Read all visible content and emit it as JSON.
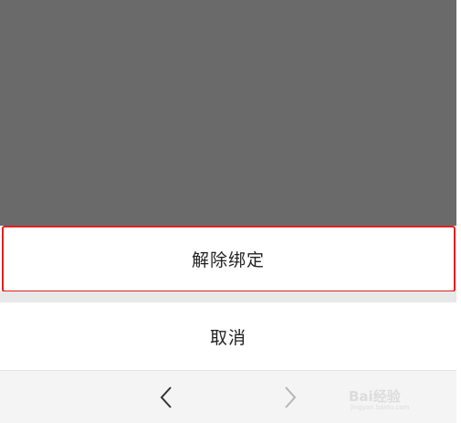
{
  "dialog": {
    "unbind_label": "解除绑定",
    "cancel_label": "取消"
  },
  "navigation": {
    "back_icon": "chevron-left-icon",
    "forward_icon": "chevron-right-icon"
  },
  "watermark": {
    "logo_text": "Bai经验",
    "sub_text": "jingyan.baidu.com"
  },
  "colors": {
    "overlay": "#6a6a6a",
    "highlight_border": "#e02020",
    "sheet": "#ffffff",
    "gap": "#e8e8e8",
    "navbar": "#f4f4f4"
  }
}
